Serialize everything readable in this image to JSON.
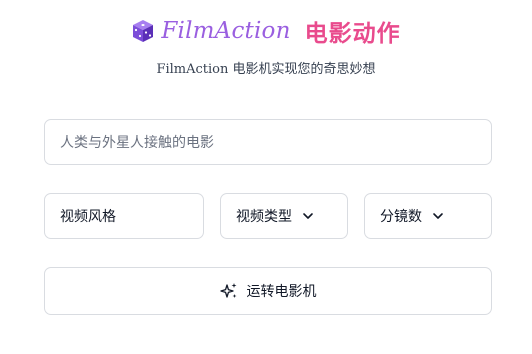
{
  "brand": {
    "logo_icon": "purple-dice-icon",
    "wordmark": "FilmAction",
    "title": "电影动作",
    "accent_purple": "#9a5fe0",
    "accent_pink": "#e94b8d"
  },
  "subtitle": "FilmAction 电影机实现您的奇思妙想",
  "prompt": {
    "value": "人类与外星人接触的电影"
  },
  "selects": {
    "style": {
      "label": "视频风格"
    },
    "type": {
      "label": "视频类型",
      "icon": "chevron-down-icon"
    },
    "shots": {
      "label": "分镜数",
      "icon": "chevron-down-icon"
    }
  },
  "run_button": {
    "label": "运转电影机",
    "icon": "sparkles-icon"
  }
}
